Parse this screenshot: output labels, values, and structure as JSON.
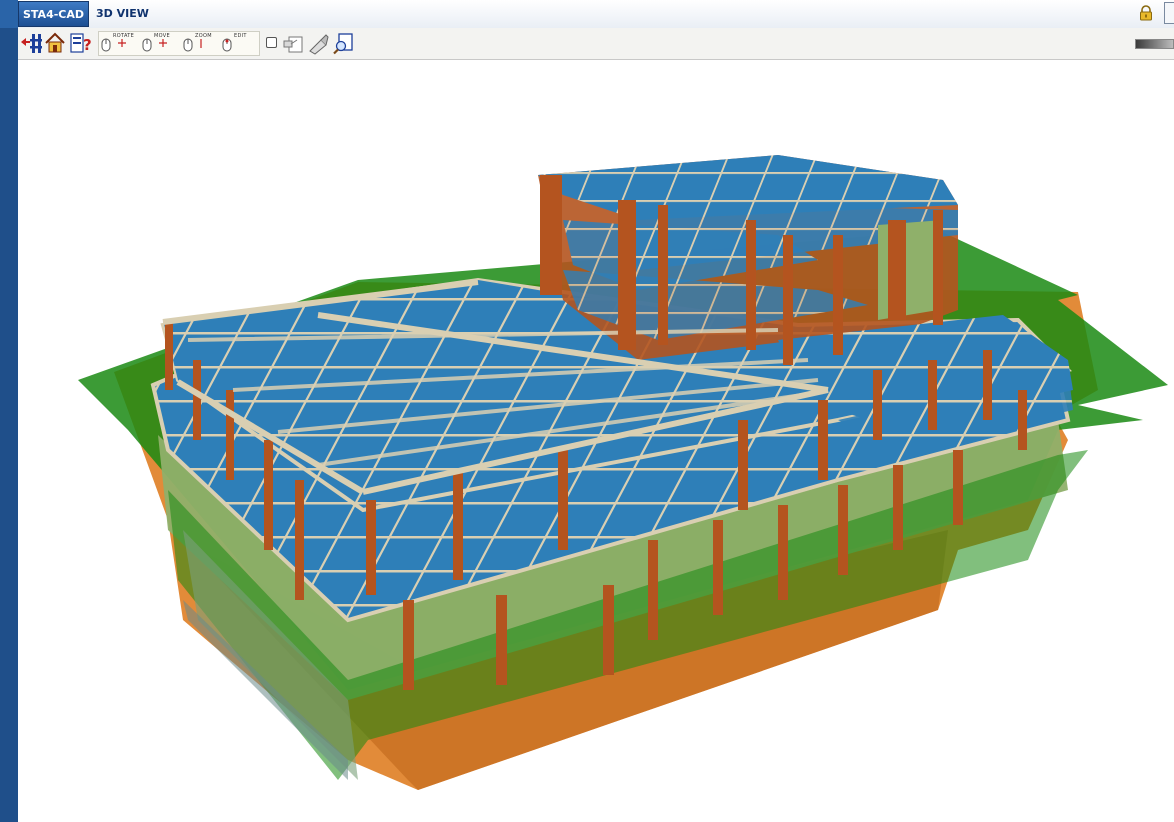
{
  "titlebar": {
    "app_tab": "STA4-CAD",
    "view_title": "3D VIEW",
    "lock_icon": "lock-icon"
  },
  "toolbar": {
    "icons": [
      "exit-plan-icon",
      "home-icon",
      "help-icon"
    ],
    "mouse_modes": [
      {
        "label": "ROTATE",
        "icon": "mouse-rotate-icon"
      },
      {
        "label": "MOVE",
        "icon": "mouse-move-icon"
      },
      {
        "label": "ZOOM",
        "icon": "mouse-zoom-icon"
      },
      {
        "label": "EDIT",
        "icon": "mouse-edit-icon"
      }
    ],
    "right_icons": [
      "copy-view-icon",
      "render-icon",
      "print-preview-icon"
    ],
    "checkbox_checked": false
  },
  "colors": {
    "slab": "#2e7fb8",
    "beam": "#d9cfb2",
    "column": "#b4541f",
    "wall": "#93b26e",
    "terrain_green": "#1a8a13",
    "terrain_orange": "#e0852e",
    "accent": "#1d4f93"
  }
}
